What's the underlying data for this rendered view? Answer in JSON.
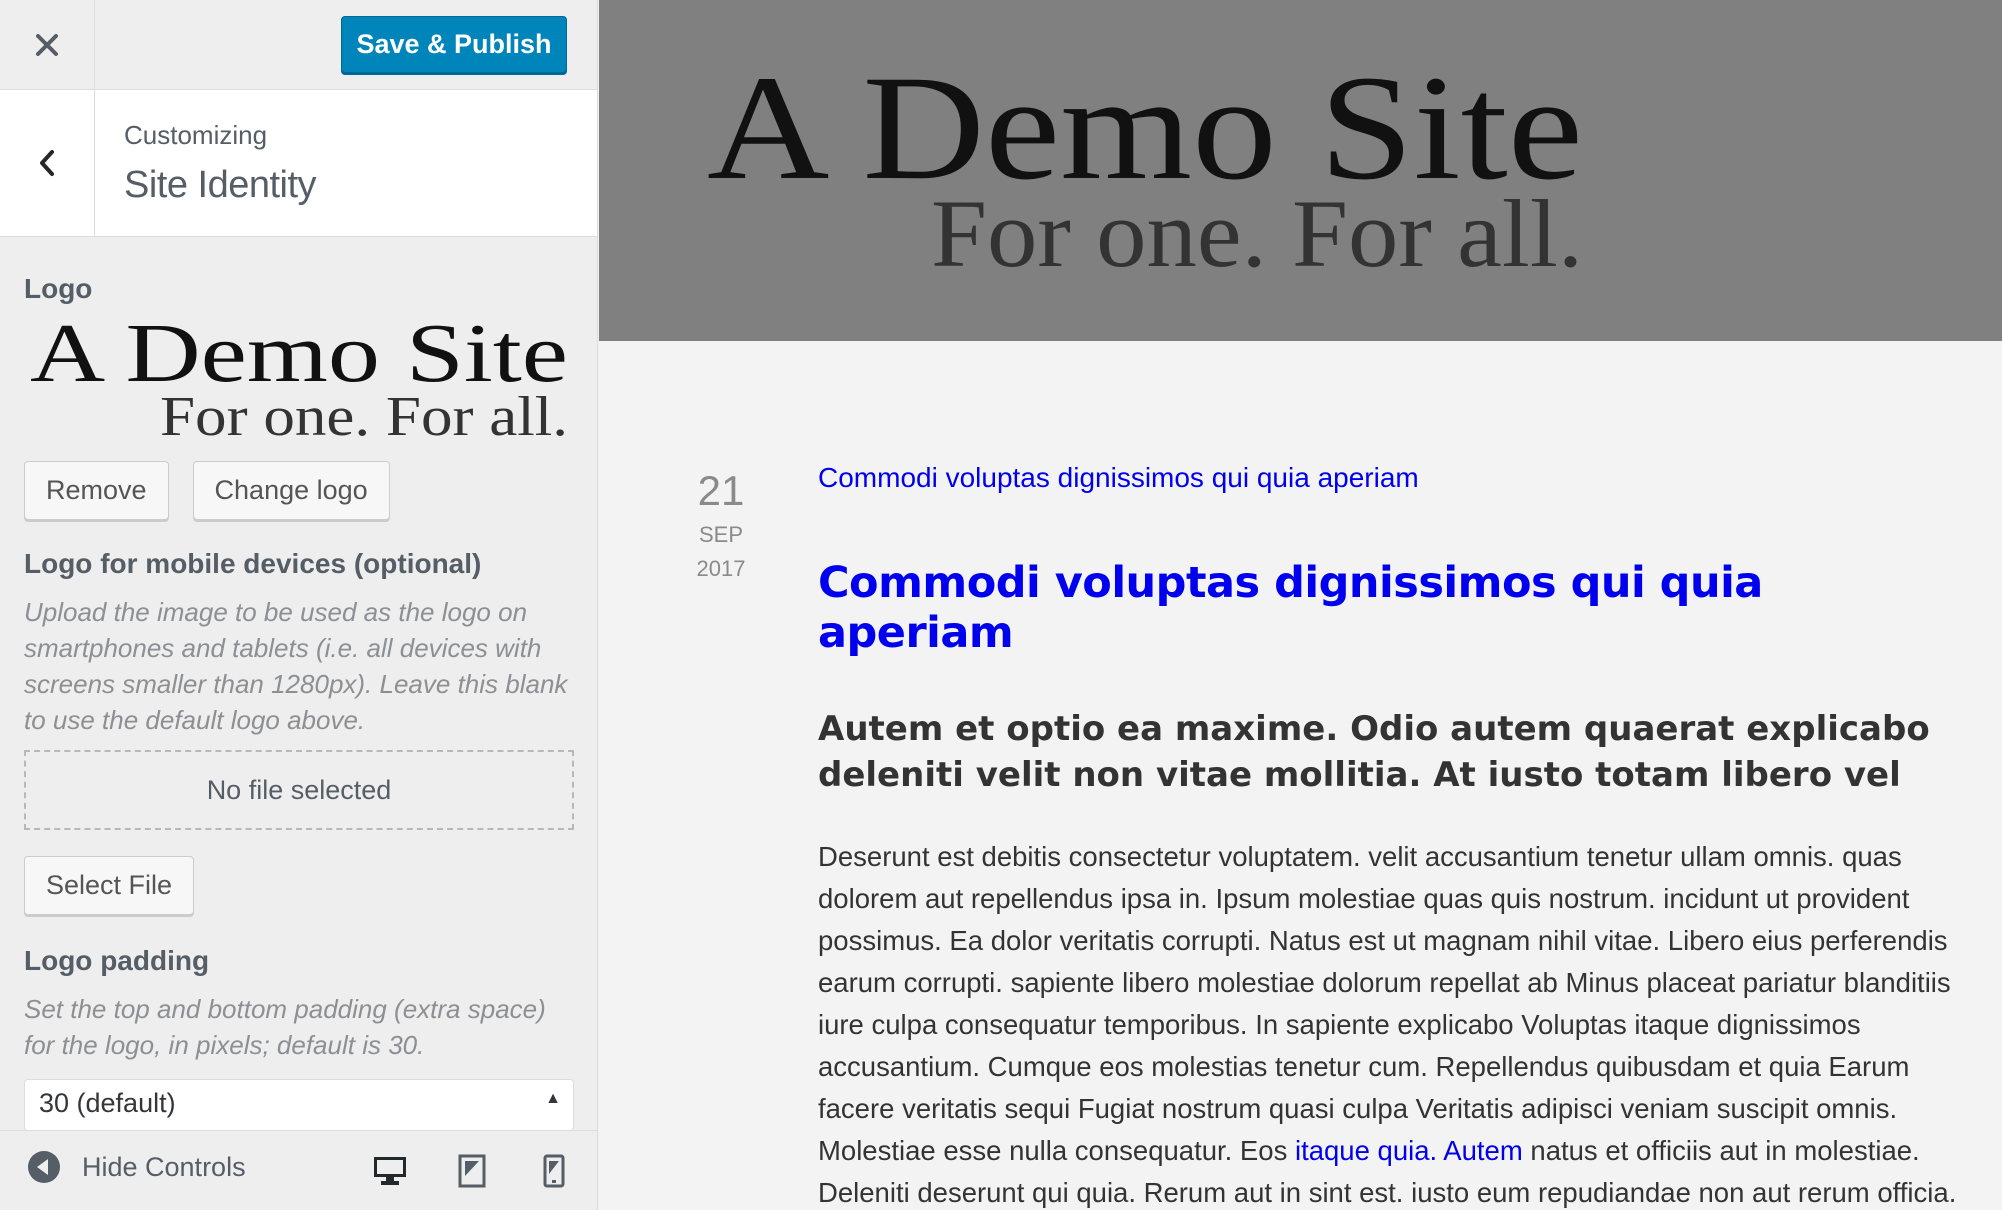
{
  "topbar": {
    "close_icon": "close-icon",
    "publish_label": "Save & Publish",
    "publish_color": "#0085ba"
  },
  "section_header": {
    "back_icon": "chevron-left-icon",
    "crumb": "Customizing",
    "title": "Site Identity"
  },
  "controls": {
    "logo": {
      "title": "Logo",
      "image_text_main": "A Demo Site",
      "image_text_tagline": "For one. For all.",
      "remove_label": "Remove",
      "change_label": "Change logo"
    },
    "mobile_logo": {
      "title": "Logo for mobile devices (optional)",
      "description": "Upload the image to be used as the logo on smartphones and tablets (i.e. all devices with screens smaller than 1280px). Leave this blank to use the default logo above.",
      "no_file": "No file selected",
      "select_label": "Select File"
    },
    "logo_padding": {
      "title": "Logo padding",
      "description": "Set the top and bottom padding (extra space) for the logo, in pixels; default is 30.",
      "selected": "30 (default)"
    }
  },
  "footer": {
    "hide_label": "Hide Controls",
    "devices": [
      "desktop-icon",
      "tablet-icon",
      "mobile-icon"
    ]
  },
  "preview": {
    "header_bg": "#808080",
    "logo_main": "A Demo Site",
    "logo_tagline": "For one. For all.",
    "post": {
      "day": "21",
      "month": "SEP",
      "year": "2017",
      "link_top": "Commodi voluptas dignissimos qui quia aperiam",
      "title": "Commodi voluptas dignissimos qui quia aperiam",
      "lead": "Autem et optio ea maxime. Odio autem quaerat explicabo deleniti velit non vitae mollitia. At iusto totam libero vel",
      "body_1": "Deserunt est debitis consectetur voluptatem. velit accusantium tenetur ullam omnis. quas dolorem aut repellendus ipsa in. Ipsum molestiae quas quis nostrum. incidunt ut provident possimus. Ea dolor veritatis corrupti. Natus est ut magnam nihil vitae. Libero eius perferendis earum corrupti. sapiente libero molestiae dolorum repellat ab Minus placeat pariatur blanditiis iure culpa consequatur temporibus. In sapiente explicabo Voluptas itaque dignissimos accusantium. Cumque eos molestias tenetur cum. Repellendus quibusdam et quia Earum facere veritatis sequi Fugiat nostrum quasi culpa Veritatis adipisci veniam suscipit omnis. Molestiae esse nulla consequatur. Eos ",
      "link_1": "itaque quia.",
      "link_2": "Autem",
      "body_2": " natus et officiis aut in molestiae. Deleniti deserunt qui quia. Rerum aut in sint est. iusto eum repudiandae non aut rerum officia. Odit omnis id. Officia itaque deserunt."
    }
  }
}
